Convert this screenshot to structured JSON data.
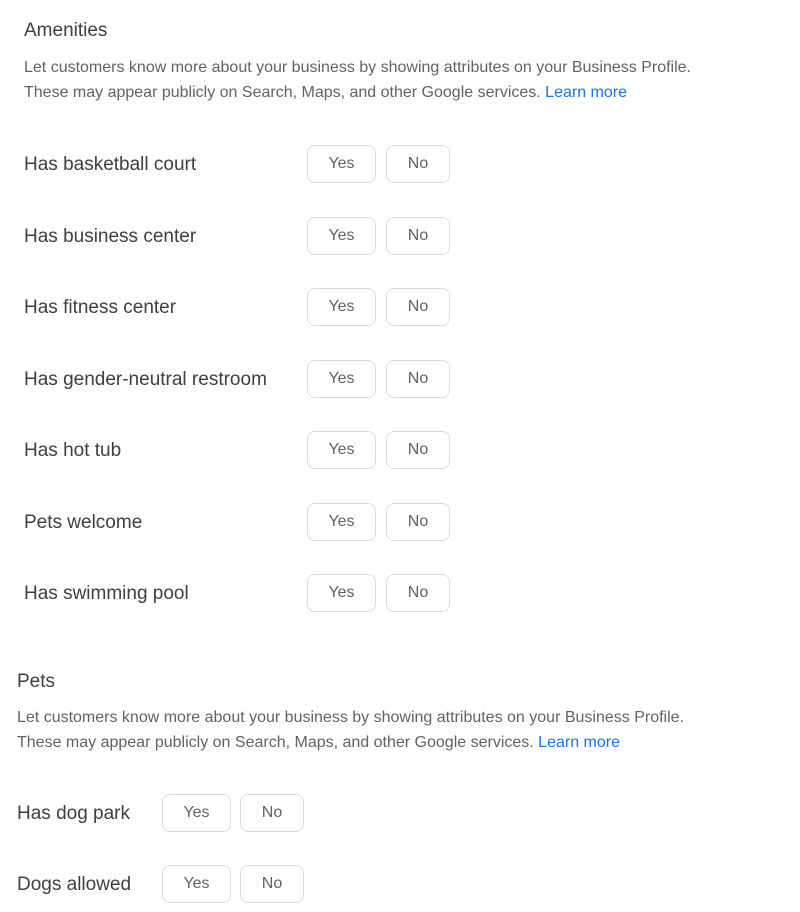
{
  "amenities": {
    "title": "Amenities",
    "description_line1": "Let customers know more about your business by showing attributes on your Business Profile.",
    "description_line2": "These may appear publicly on Search, Maps, and other Google services.",
    "learn_more": "Learn more",
    "items": [
      {
        "label": "Has basketball court",
        "yes": "Yes",
        "no": "No"
      },
      {
        "label": "Has business center",
        "yes": "Yes",
        "no": "No"
      },
      {
        "label": "Has fitness center",
        "yes": "Yes",
        "no": "No"
      },
      {
        "label": "Has gender-neutral restroom",
        "yes": "Yes",
        "no": "No"
      },
      {
        "label": "Has hot tub",
        "yes": "Yes",
        "no": "No"
      },
      {
        "label": "Pets welcome",
        "yes": "Yes",
        "no": "No"
      },
      {
        "label": "Has swimming pool",
        "yes": "Yes",
        "no": "No"
      }
    ]
  },
  "pets": {
    "title": "Pets",
    "description_line1": "Let customers know more about your business by showing attributes on your Business Profile.",
    "description_line2": "These may appear publicly on Search, Maps, and other Google services.",
    "learn_more": "Learn more",
    "items": [
      {
        "label": "Has dog park",
        "yes": "Yes",
        "no": "No"
      },
      {
        "label": "Dogs allowed",
        "yes": "Yes",
        "no": "No"
      }
    ]
  },
  "colors": {
    "link": "#1a73e8",
    "text": "#3c4043",
    "secondary_text": "#5f6368",
    "button_border": "#dadce0"
  }
}
